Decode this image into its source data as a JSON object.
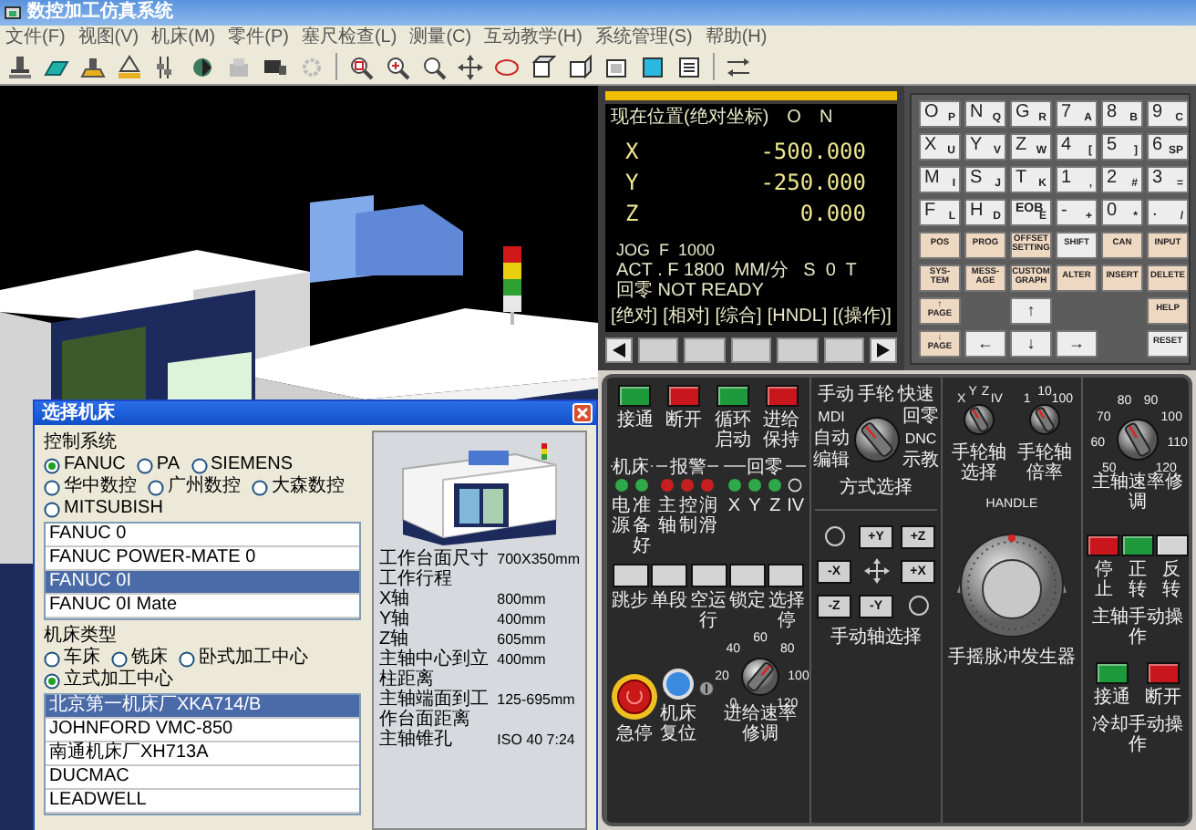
{
  "window": {
    "title": "数控加工仿真系统"
  },
  "menu": [
    "文件(F)",
    "视图(V)",
    "机床(M)",
    "零件(P)",
    "塞尺检查(L)",
    "测量(C)",
    "互动教学(H)",
    "系统管理(S)",
    "帮助(H)"
  ],
  "cnc_screen": {
    "title": "现在位置(绝对坐标)",
    "program_label": "O",
    "sequence_label": "N",
    "axes": [
      {
        "name": "X",
        "value": "-500.000"
      },
      {
        "name": "Y",
        "value": "-250.000"
      },
      {
        "name": "Z",
        "value": "0.000"
      }
    ],
    "status_lines": [
      "JOG  F  1000",
      "ACT . F 1800  MM/分   S  0  T",
      "回零 NOT READY"
    ],
    "softkeys": [
      "[绝对]",
      "[相对]",
      "[综合]",
      "[HNDL]",
      "[(操作)]"
    ]
  },
  "keypad": {
    "keys": [
      {
        "kind": "address",
        "main": "O",
        "sub": "P"
      },
      {
        "kind": "address",
        "main": "N",
        "sub": "Q"
      },
      {
        "kind": "address",
        "main": "G",
        "sub": "R"
      },
      {
        "kind": "address",
        "main": "7",
        "sub": "A"
      },
      {
        "kind": "address",
        "main": "8",
        "sub": "B"
      },
      {
        "kind": "address",
        "main": "9",
        "sub": "C"
      },
      {
        "kind": "address",
        "main": "X",
        "sub": "U"
      },
      {
        "kind": "address",
        "main": "Y",
        "sub": "V"
      },
      {
        "kind": "address",
        "main": "Z",
        "sub": "W"
      },
      {
        "kind": "address",
        "main": "4",
        "sub": "["
      },
      {
        "kind": "address",
        "main": "5",
        "sub": "]"
      },
      {
        "kind": "address",
        "main": "6",
        "sub": "SP"
      },
      {
        "kind": "address",
        "main": "M",
        "sub": "I"
      },
      {
        "kind": "address",
        "main": "S",
        "sub": "J"
      },
      {
        "kind": "address",
        "main": "T",
        "sub": "K"
      },
      {
        "kind": "address",
        "main": "1",
        "sub": ","
      },
      {
        "kind": "address",
        "main": "2",
        "sub": "#"
      },
      {
        "kind": "address",
        "main": "3",
        "sub": "="
      },
      {
        "kind": "address",
        "main": "F",
        "sub": "L"
      },
      {
        "kind": "address",
        "main": "H",
        "sub": "D"
      },
      {
        "kind": "address",
        "main": "EOB",
        "sub": "E"
      },
      {
        "kind": "address",
        "main": "-",
        "sub": "+"
      },
      {
        "kind": "address",
        "main": "0",
        "sub": "*"
      },
      {
        "kind": "address",
        "main": ".",
        "sub": "/"
      },
      {
        "kind": "function",
        "main": "POS"
      },
      {
        "kind": "function",
        "main": "PROG"
      },
      {
        "kind": "function",
        "main": "OFFSET SETTING"
      },
      {
        "kind": "plain",
        "main": "SHIFT"
      },
      {
        "kind": "function",
        "main": "CAN"
      },
      {
        "kind": "function",
        "main": "INPUT"
      },
      {
        "kind": "function",
        "main": "SYS-TEM"
      },
      {
        "kind": "function",
        "main": "MESS-AGE"
      },
      {
        "kind": "function",
        "main": "CUSTOM GRAPH"
      },
      {
        "kind": "function",
        "main": "ALTER"
      },
      {
        "kind": "function",
        "main": "INSERT"
      },
      {
        "kind": "function",
        "main": "DELETE"
      },
      {
        "kind": "function",
        "main": "↑ PAGE"
      },
      {
        "kind": "blank"
      },
      {
        "kind": "plain",
        "main": "↑"
      },
      {
        "kind": "blank"
      },
      {
        "kind": "blank"
      },
      {
        "kind": "function",
        "main": "HELP"
      },
      {
        "kind": "function",
        "main": "↓ PAGE"
      },
      {
        "kind": "plain",
        "main": "←"
      },
      {
        "kind": "plain",
        "main": "↓"
      },
      {
        "kind": "plain",
        "main": "→"
      },
      {
        "kind": "blank"
      },
      {
        "kind": "plain",
        "main": "RESET"
      }
    ]
  },
  "control_panel": {
    "power_buttons": [
      {
        "label": "接通",
        "color": "#1e9a3c"
      },
      {
        "label": "断开",
        "color": "#c8161c"
      },
      {
        "label": "循环启动",
        "color": "#1e9a3c"
      },
      {
        "label": "进给保持",
        "color": "#c8161c"
      }
    ],
    "indicator_groups": [
      {
        "title": "机床",
        "lights": [
          {
            "label": "电源",
            "on": true,
            "color": "#2fa84a"
          },
          {
            "label": "准备好",
            "on": true,
            "color": "#2fa84a"
          }
        ]
      },
      {
        "title": "报警",
        "lights": [
          {
            "label": "主轴",
            "on": true,
            "color": "#c81e1e"
          },
          {
            "label": "控制",
            "on": true,
            "color": "#c81e1e"
          },
          {
            "label": "润滑",
            "on": true,
            "color": "#c81e1e"
          }
        ]
      },
      {
        "title": "回零",
        "lights": [
          {
            "label": "X",
            "on": true,
            "color": "#2fa84a"
          },
          {
            "label": "Y",
            "on": true,
            "color": "#2fa84a"
          },
          {
            "label": "Z",
            "on": true,
            "color": "#2fa84a"
          },
          {
            "label": "IV",
            "on": false
          }
        ]
      }
    ],
    "function_buttons": [
      "跳步",
      "单段",
      "空运行",
      "锁定",
      "选择停"
    ],
    "emergency_stop": {
      "label": "急停"
    },
    "reset_button": {
      "label": "机床复位"
    },
    "feed_override": {
      "label": "进给速率修调",
      "ticks": [
        "0",
        "20",
        "40",
        "60",
        "80",
        "100",
        "120"
      ]
    },
    "mode_selector": {
      "label": "方式选择",
      "top_labels": [
        "手动",
        "手轮",
        "快速"
      ],
      "left_labels": [
        "MDI",
        "自动",
        "编辑"
      ],
      "right_labels": [
        "回零",
        "DNC",
        "示教"
      ]
    },
    "jog_axes": {
      "label": "手动轴选择",
      "buttons": [
        "+Y",
        "+Z",
        "-X",
        "+X",
        "-Z",
        "-Y"
      ]
    },
    "handwheel_axis": {
      "label": "手轮轴选择",
      "ticks": [
        "X",
        "Y",
        "Z",
        "IV"
      ]
    },
    "handwheel_rate": {
      "label": "手轮轴倍率",
      "ticks": [
        "1",
        "10",
        "100"
      ]
    },
    "handwheel": {
      "caption": "HANDLE",
      "label": "手摇脉冲发生器"
    },
    "spindle_override": {
      "label": "主轴速率修调",
      "ticks": [
        "50",
        "60",
        "70",
        "80",
        "90",
        "100",
        "110",
        "120"
      ]
    },
    "spindle_buttons": {
      "label": "主轴手动操作",
      "buttons": [
        {
          "label": "停止",
          "color": "#c8161c"
        },
        {
          "label": "正转",
          "color": "#1e9a3c"
        },
        {
          "label": "反转",
          "color": "#d4d4d4"
        }
      ]
    },
    "coolant_buttons": {
      "label": "冷却手动操作",
      "buttons": [
        {
          "label": "接通",
          "color": "#1e9a3c"
        },
        {
          "label": "断开",
          "color": "#c8161c"
        }
      ]
    }
  },
  "dialog": {
    "title": "选择机床",
    "control_system": {
      "label": "控制系统",
      "options": [
        {
          "label": "FANUC",
          "selected": true
        },
        {
          "label": "PA",
          "selected": false
        },
        {
          "label": "SIEMENS",
          "selected": false
        },
        {
          "label": "华中数控",
          "selected": false
        },
        {
          "label": "广州数控",
          "selected": false
        },
        {
          "label": "大森数控",
          "selected": false
        },
        {
          "label": "MITSUBISH",
          "selected": false
        }
      ]
    },
    "systems": [
      {
        "label": "FANUC 0",
        "selected": false
      },
      {
        "label": "FANUC POWER-MATE 0",
        "selected": false
      },
      {
        "label": "FANUC 0I",
        "selected": true
      },
      {
        "label": "FANUC 0I Mate",
        "selected": false
      }
    ],
    "machine_type": {
      "label": "机床类型",
      "options": [
        {
          "label": "车床",
          "selected": false
        },
        {
          "label": "铣床",
          "selected": false
        },
        {
          "label": "卧式加工中心",
          "selected": false
        },
        {
          "label": "立式加工中心",
          "selected": true
        }
      ]
    },
    "machines": [
      {
        "label": "北京第一机床厂XKA714/B",
        "selected": true
      },
      {
        "label": "JOHNFORD VMC-850",
        "selected": false
      },
      {
        "label": "南通机床厂XH713A",
        "selected": false
      },
      {
        "label": "DUCMAC",
        "selected": false
      },
      {
        "label": "LEADWELL",
        "selected": false
      }
    ],
    "specs": [
      {
        "name": "工作台面尺寸",
        "value": "700X350mm"
      },
      {
        "name": "工作行程"
      },
      {
        "name": "X轴",
        "value": "800mm"
      },
      {
        "name": "Y轴",
        "value": "400mm"
      },
      {
        "name": "Z轴",
        "value": "605mm"
      },
      {
        "name": "主轴中心到立柱距离",
        "value": "400mm"
      },
      {
        "name": "主轴端面到工作台面距离",
        "value": "125-695mm"
      },
      {
        "name": "主轴锥孔",
        "value": "ISO 40 7:24"
      }
    ]
  }
}
